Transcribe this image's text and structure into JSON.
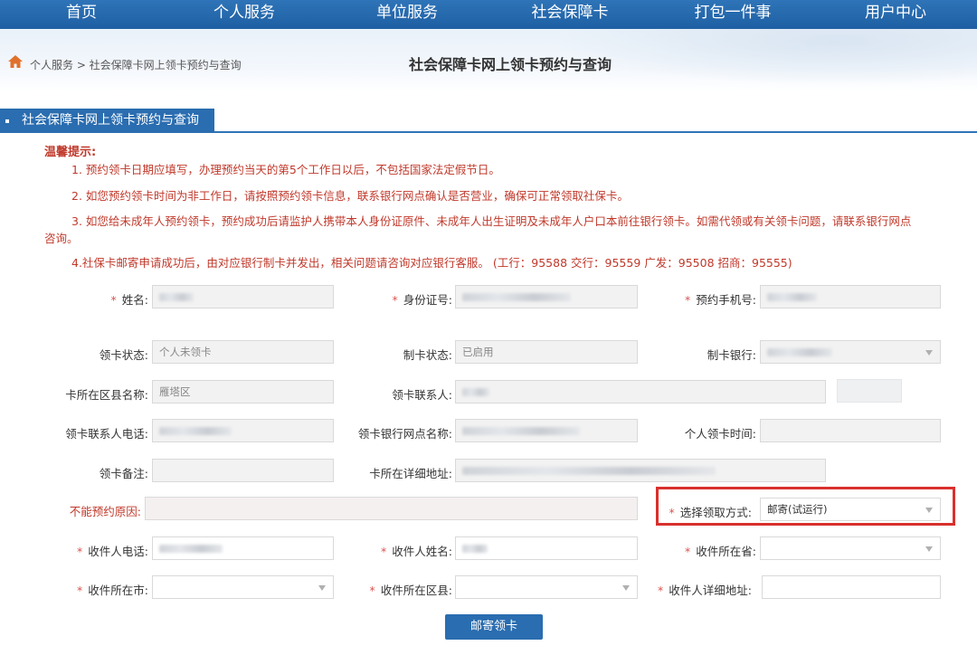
{
  "nav": {
    "items": [
      "首页",
      "个人服务",
      "单位服务",
      "社会保障卡",
      "打包一件事",
      "用户中心"
    ]
  },
  "breadcrumb": "个人服务 > 社会保障卡网上领卡预约与查询",
  "page_title": "社会保障卡网上领卡预约与查询",
  "section_title": "社会保障卡网上领卡预约与查询",
  "notice": {
    "title": "温馨提示:",
    "line1": "1. 预约领卡日期应填写，办理预约当天的第5个工作日以后，不包括国家法定假节日。",
    "line2": "2. 如您预约领卡时间为非工作日，请按照预约领卡信息，联系银行网点确认是否营业，确保可正常领取社保卡。",
    "line3a": "3. 如您给未成年人预约领卡，预约成功后请监护人携带本人身份证原件、未成年人出生证明及未成年人户口本前往银行领卡。如需代领或有关领卡问题，请联系银行网点",
    "line3b": "咨询。",
    "line4": "4.社保卡邮寄申请成功后，由对应银行制卡并发出，相关问题请咨询对应银行客服。 (工行：95588    交行：95559    广发：95508    招商：95555)"
  },
  "form": {
    "name_label": "姓名:",
    "idcard_label": "身份证号:",
    "phone_label": "预约手机号:",
    "card_status_label": "领卡状态:",
    "card_status_value": "个人未领卡",
    "make_status_label": "制卡状态:",
    "make_status_value": "已启用",
    "bank_label": "制卡银行:",
    "district_label": "卡所在区县名称:",
    "district_value": "雁塔区",
    "contact_label": "领卡联系人:",
    "contact_phone_label": "领卡联系人电话:",
    "branch_label": "领卡银行网点名称:",
    "personal_time_label": "个人领卡时间:",
    "remark_label": "领卡备注:",
    "address_label": "卡所在详细地址:",
    "reason_label": "不能预约原因:",
    "method_label": "选择领取方式:",
    "method_value": "邮寄(试运行)",
    "recv_phone_label": "收件人电话:",
    "recv_name_label": "收件人姓名:",
    "recv_province_label": "收件所在省:",
    "recv_city_label": "收件所在市:",
    "recv_district_label": "收件所在区县:",
    "recv_address_label": "收件人详细地址:",
    "submit_label": "邮寄领卡"
  },
  "colors": {
    "nav_blue": "#1e5fa3",
    "notice_red": "#c0392b",
    "highlight_red": "#d9302c"
  }
}
